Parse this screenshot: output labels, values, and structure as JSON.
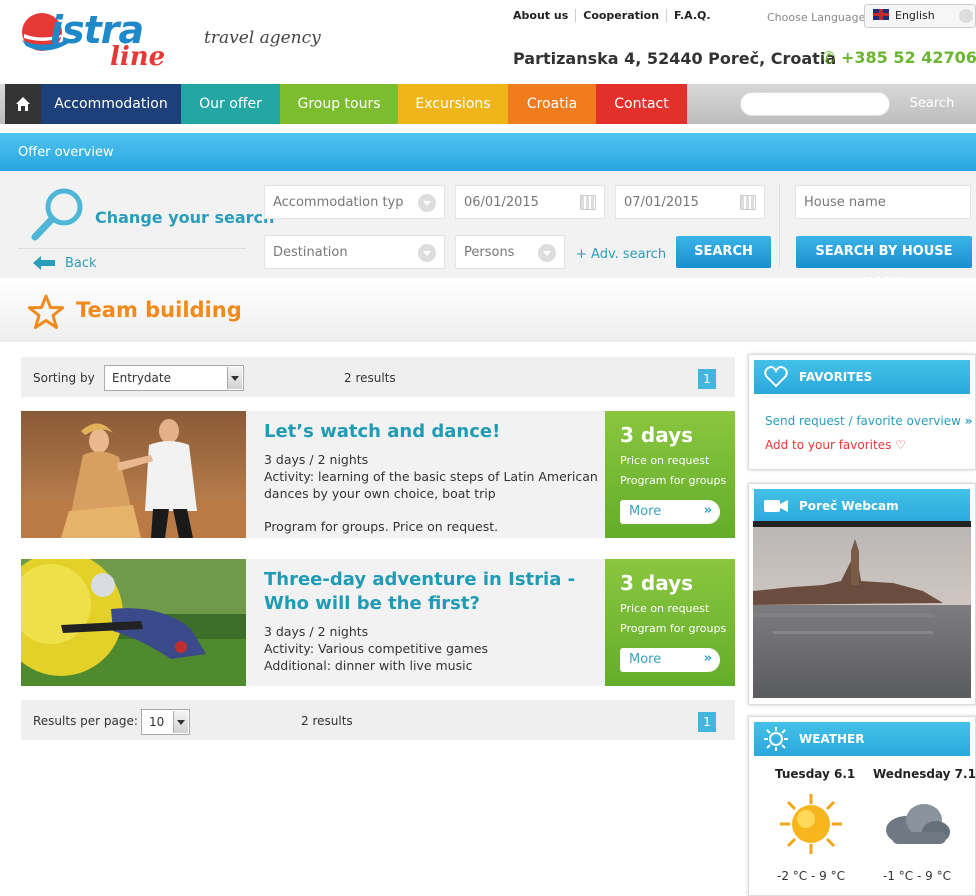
{
  "header": {
    "logo_main": "istra",
    "logo_sub": "line",
    "tagline": "travel agency",
    "top_links": [
      "About us",
      "Cooperation",
      "F.A.Q."
    ],
    "language_label": "Choose Language",
    "language_selected": "English",
    "address": "Partizanska 4, 52440 Poreč, Croatia",
    "phone": "+385 52 42706"
  },
  "nav": {
    "items": [
      {
        "label": "Accommodation",
        "color": "#1d3f7a"
      },
      {
        "label": "Our offer",
        "color": "#24a7a4"
      },
      {
        "label": "Group tours",
        "color": "#7cbc2f"
      },
      {
        "label": "Excursions",
        "color": "#f1b51c"
      },
      {
        "label": "Croatia",
        "color": "#f07c1e"
      },
      {
        "label": "Contact",
        "color": "#e3302b"
      }
    ],
    "search_label": "Search"
  },
  "breadcrumb": "Offer overview",
  "search": {
    "change_label": "Change your search",
    "back_label": "Back",
    "accommodation_type": "Accommodation typ",
    "date_from": "06/01/2015",
    "date_to": "07/01/2015",
    "house_name_placeholder": "House name",
    "destination": "Destination",
    "persons": "Persons",
    "adv_search": "+ Adv. search",
    "search_button": "SEARCH",
    "search_house_button": "SEARCH BY HOUSE NAME"
  },
  "page_title": "Team building",
  "results": {
    "sorting_label": "Sorting by",
    "sorting_value": "Entrydate",
    "count_text": "2  results",
    "page": "1",
    "per_page_label": "Results per page:",
    "per_page_value": "10"
  },
  "offers": [
    {
      "title": "Let’s watch and dance!",
      "desc_line1": "3 days / 2 nights",
      "desc_line2": "Activity: learning of the basic steps of Latin American dances by your own choice, boat trip",
      "desc_line3": "Program for groups. Price on request.",
      "duration": "3 days",
      "price": "Price on request",
      "program": "Program for groups",
      "more": "More"
    },
    {
      "title": "Three-day adventure in Istria - Who will be the first?",
      "desc_line1": "3 days / 2 nights",
      "desc_line2": "Activity: Various competitive games",
      "desc_line3": "Additional:  dinner with live music",
      "duration": "3 days",
      "price": "Price on request",
      "program": "Program for groups",
      "more": "More"
    }
  ],
  "sidebar": {
    "favorites_title": "FAVORITES",
    "send_request": "Send request / favorite overview",
    "add_favorites": "Add to your favorites",
    "webcam_title": "Poreč Webcam",
    "weather_title": "WEATHER",
    "weather": [
      {
        "day": "Tuesday 6.1",
        "temp": "-2 °C - 9 °C",
        "icon": "sun-icon"
      },
      {
        "day": "Wednesday 7.1",
        "temp": "-1 °C - 9 °C",
        "icon": "cloud-icon"
      }
    ]
  }
}
